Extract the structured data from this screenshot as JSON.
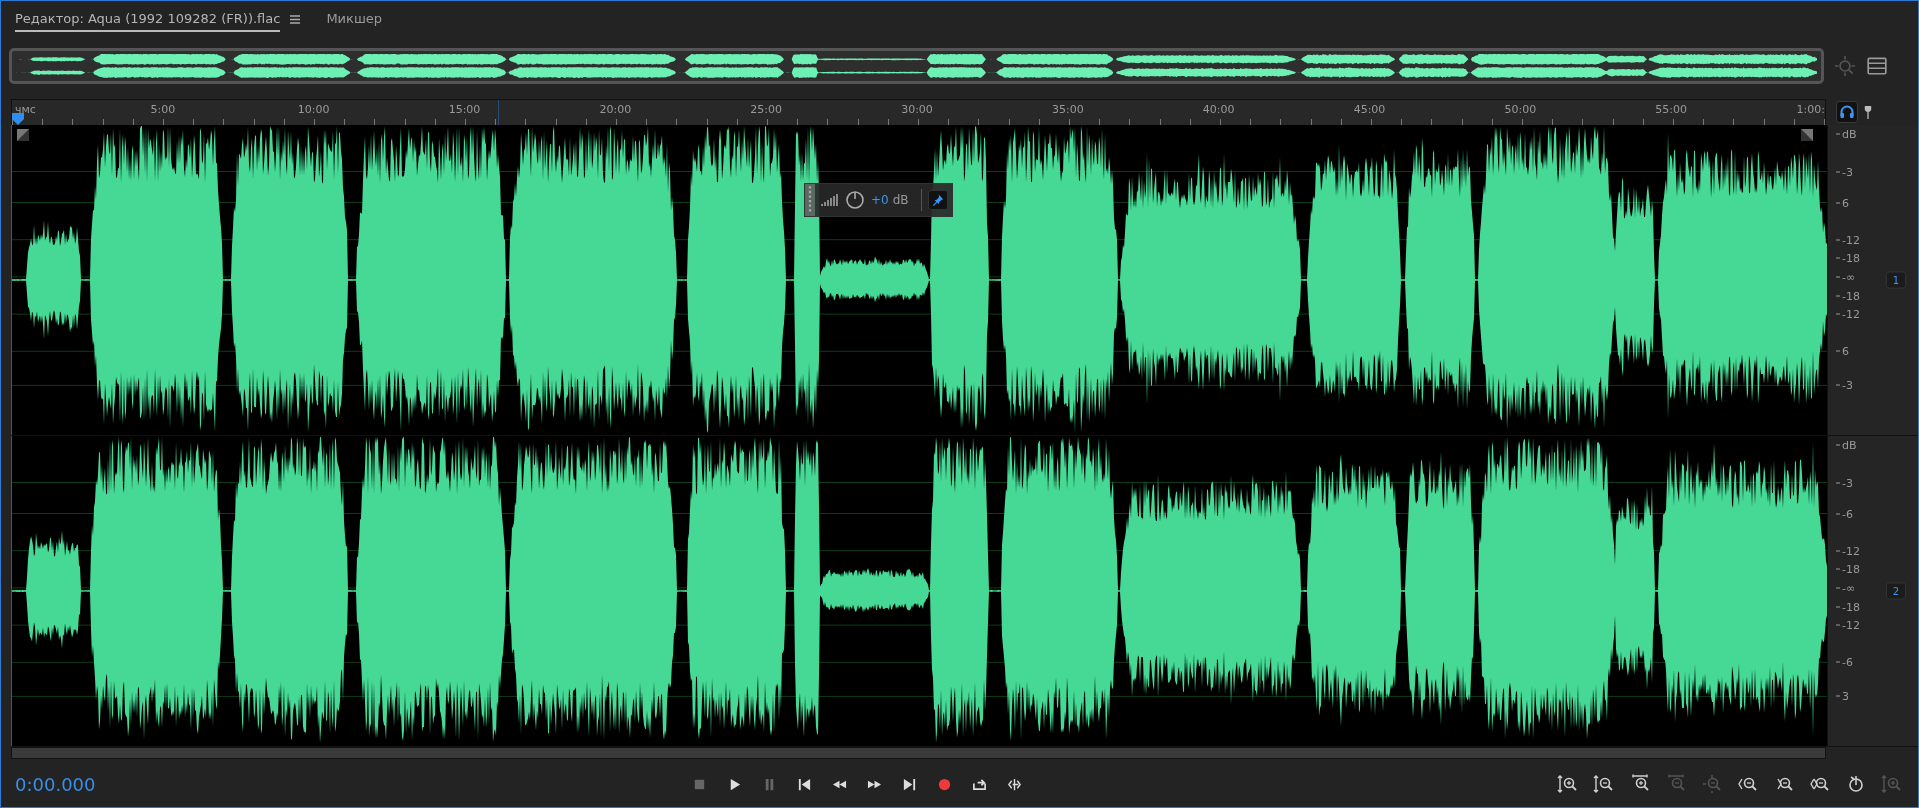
{
  "tabs": [
    {
      "label": "Редактор: Aqua (1992 109282 (FR)).flac",
      "selected": true,
      "menu": true
    },
    {
      "label": "Микшер",
      "selected": false,
      "menu": false
    }
  ],
  "monitor": {
    "selected": true
  },
  "ruler": {
    "unit": "чмс",
    "labels": [
      "5:00",
      "10:00",
      "15:00",
      "20:00",
      "25:00",
      "30:00",
      "35:00",
      "40:00",
      "45:00",
      "50:00",
      "55:00",
      "1:00:"
    ]
  },
  "hud": {
    "value": "+0",
    "unit": "dB",
    "pinned": true
  },
  "channels": [
    {
      "number": "1",
      "scale": [
        "dB",
        "-3",
        "6",
        "-12",
        "-18",
        "-∞",
        "-18",
        "-12",
        "6",
        "-3"
      ]
    },
    {
      "number": "2",
      "scale": [
        "dB",
        "-3",
        "-6",
        "-12",
        "-18",
        "-∞",
        "-18",
        "-12",
        "-6",
        "3"
      ]
    }
  ],
  "time": "0:00.000",
  "transport": [
    {
      "kind": "stop",
      "disabled": true
    },
    {
      "kind": "play",
      "disabled": false
    },
    {
      "kind": "pause",
      "disabled": true
    },
    {
      "kind": "to-start",
      "disabled": false
    },
    {
      "kind": "rewind",
      "disabled": false
    },
    {
      "kind": "forward",
      "disabled": false
    },
    {
      "kind": "to-end",
      "disabled": false
    },
    {
      "kind": "record",
      "disabled": false
    },
    {
      "kind": "loop",
      "disabled": false
    },
    {
      "kind": "skip",
      "disabled": false
    }
  ],
  "zoom_tools": [
    {
      "kind": "amp-in",
      "disabled": false
    },
    {
      "kind": "amp-out",
      "disabled": false
    },
    {
      "kind": "time-in",
      "disabled": false
    },
    {
      "kind": "time-out",
      "disabled": true
    },
    {
      "kind": "full",
      "disabled": true
    },
    {
      "kind": "sel-in",
      "disabled": false
    },
    {
      "kind": "sel-out",
      "disabled": false
    },
    {
      "kind": "sel-both",
      "disabled": false
    },
    {
      "kind": "reset",
      "disabled": false
    },
    {
      "kind": "amp-reset",
      "disabled": true
    }
  ]
}
